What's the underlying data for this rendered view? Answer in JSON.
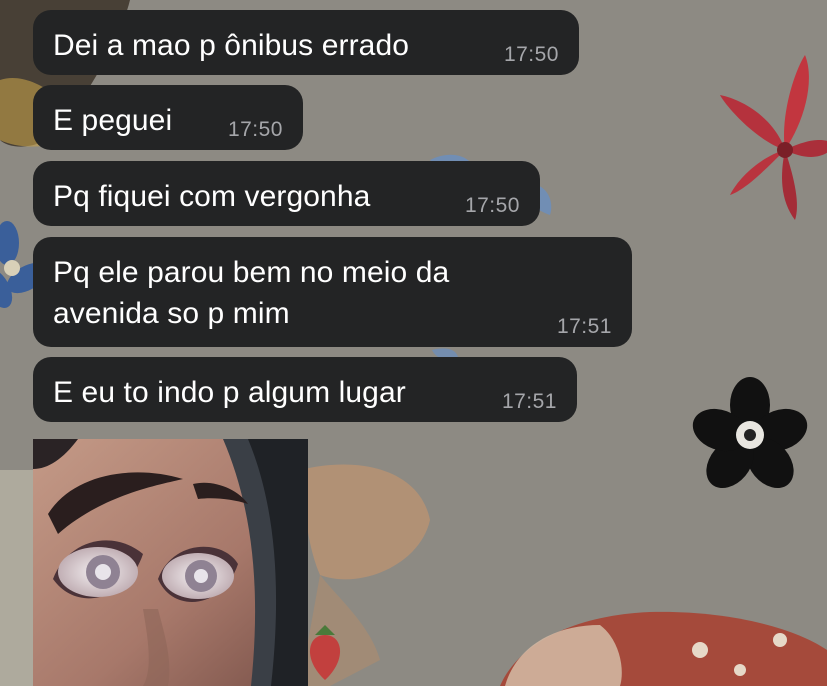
{
  "chat": {
    "messages": [
      {
        "text": "Dei a mao p ônibus errado",
        "time": "17:50"
      },
      {
        "text": "E peguei",
        "time": "17:50"
      },
      {
        "text": "Pq fiquei com vergonha",
        "time": "17:50"
      },
      {
        "text_line1": "Pq ele parou bem no meio da",
        "text_line2": "avenida so p mim",
        "time": "17:51"
      },
      {
        "text": "E eu to indo p algum lugar",
        "time": "17:51"
      }
    ],
    "sticker": {
      "icon": "face-eyes-sticker"
    }
  },
  "colors": {
    "wallpaper": "#8d8a83",
    "bubble": "#232425",
    "text": "#ffffff",
    "timestamp": "#a5a6aa"
  }
}
